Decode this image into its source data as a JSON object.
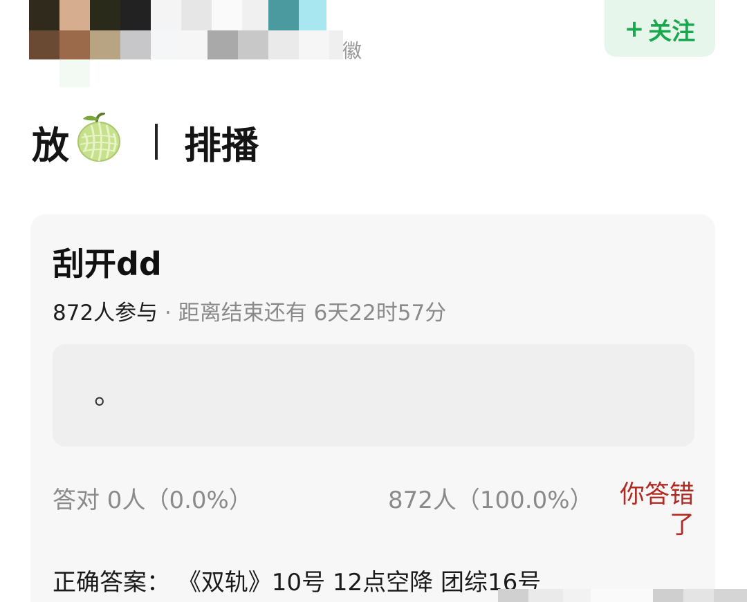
{
  "header": {
    "obscured_text_fragment": "徽",
    "follow_button": {
      "plus": "+",
      "label": "关注",
      "color": "#1aa84f"
    }
  },
  "post": {
    "title_left": "放",
    "title_emoji_icon": "melon-icon",
    "title_right": "排播"
  },
  "quiz": {
    "title": "刮开dd",
    "participants": "872人参与",
    "separator": " · ",
    "time_left": "距离结束还有 6天22时57分",
    "option_text": "。",
    "correct_stat": "答对  0人（0.0%）",
    "wrong_stat": "872人（100.0%）",
    "you_answered_wrong": "你答错了",
    "answer_label": "正确答案：",
    "answer_value": "《双轨》10号 12点空降 团综16号",
    "accent_color": "#b22a22"
  }
}
